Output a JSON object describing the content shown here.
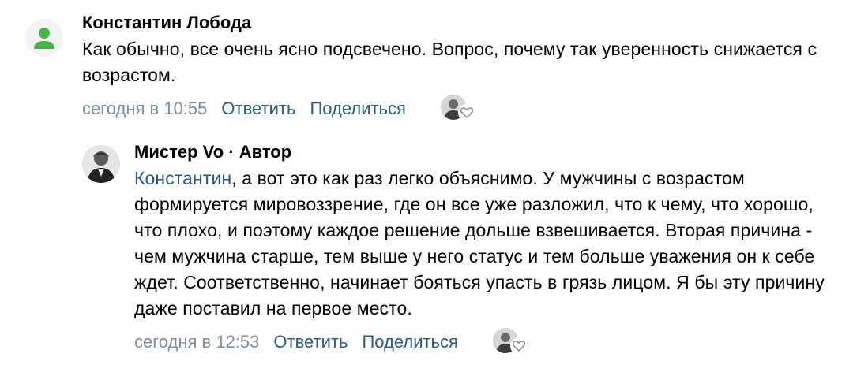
{
  "comments": [
    {
      "author": "Константин Лобода",
      "text": "Как обычно, все очень ясно подсвечено. Вопрос, почему так уверенность снижается с возрастом.",
      "date": "сегодня в 10:55",
      "reply_label": "Ответить",
      "share_label": "Поделиться",
      "avatar_icon": "default-user-icon",
      "avatar_color": "#4bb34b"
    },
    {
      "author": "Мистер Vo",
      "author_suffix": " · Автор",
      "mention": "Константин",
      "text": ", а вот это как раз легко объяснимо. У мужчины с возрастом формируется мировоззрение, где он все уже разложил, что к чему, что хорошо, что плохо, и поэтому каждое решение дольше взвешивается. Вторая причина - чем мужчина старше, тем выше у него статус и тем больше уважения он к себе ждет. Соответственно, начинает бояться упасть в грязь лицом. Я бы эту причину даже поставил на первое место.",
      "date": "сегодня в 12:53",
      "reply_label": "Ответить",
      "share_label": "Поделиться",
      "avatar_icon": "portrait-photo"
    }
  ],
  "colors": {
    "link": "#2a5885",
    "muted": "#818c99",
    "text": "#000000"
  }
}
